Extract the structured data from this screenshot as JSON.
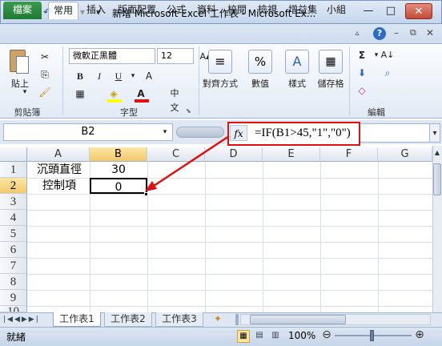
{
  "window": {
    "title": "新增 Microsoft Excel 工作表 - Microsoft Ex...",
    "logo": "X",
    "min_glyph": "—",
    "max_glyph": "□",
    "close_glyph": "✕"
  },
  "ribbon_tabs": {
    "file": "檔案",
    "home": "常用",
    "insert": "插入",
    "layout": "版面配置",
    "formula": "公式",
    "data": "資料",
    "review": "校閱",
    "view": "檢視",
    "addin": "增益集",
    "group": "小組"
  },
  "ribbon": {
    "paste": "貼上",
    "clipboard_label": "剪貼簿",
    "font_name": "微軟正黑體",
    "font_size": "12",
    "bold": "B",
    "italic": "I",
    "underline": "U",
    "font_color_letter": "A",
    "font_label": "字型",
    "align": "對齊方式",
    "number": "數值",
    "styles": "樣式",
    "cells": "儲存格",
    "editing_label": "編輯",
    "sigma": "Σ",
    "percent": "%"
  },
  "formula_bar": {
    "name_box": "B2",
    "fx": "fx",
    "formula": "=IF(B1>45,\"1\",\"0\")"
  },
  "columns": [
    "A",
    "B",
    "C",
    "D",
    "E",
    "F",
    "G"
  ],
  "rows": [
    "1",
    "2",
    "3",
    "4",
    "5",
    "6",
    "7",
    "8",
    "9",
    "10"
  ],
  "cells": {
    "a1": "沉頭直徑",
    "b1": "30",
    "a2": "控制項",
    "b2": "0"
  },
  "sheets": [
    "工作表1",
    "工作表2",
    "工作表3"
  ],
  "status": {
    "ready": "就緒",
    "zoom": "100%"
  },
  "colors": {
    "accent": "#1f7a34",
    "highlight": "#e01010",
    "header_selected": "#f3c86a"
  }
}
